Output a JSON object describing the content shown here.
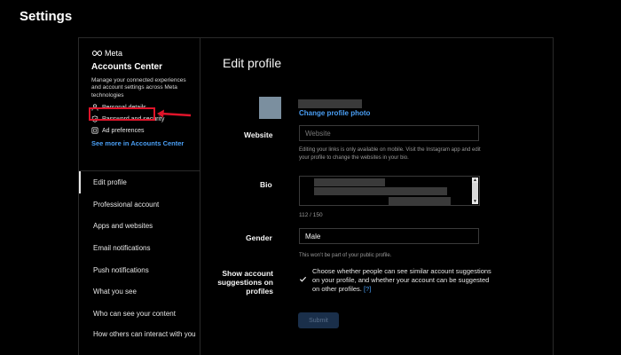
{
  "page": {
    "title": "Settings"
  },
  "accounts_center": {
    "brand": "Meta",
    "title": "Accounts Center",
    "description": "Manage your connected experiences and account settings across Meta technologies",
    "links": [
      {
        "label": "Personal details",
        "icon": "person-icon"
      },
      {
        "label": "Password and security",
        "icon": "shield-check-icon"
      },
      {
        "label": "Ad preferences",
        "icon": "ad-icon"
      }
    ],
    "see_more": "See more in Accounts Center"
  },
  "nav": [
    {
      "label": "Edit profile",
      "active": true
    },
    {
      "label": "Professional account"
    },
    {
      "label": "Apps and websites"
    },
    {
      "label": "Email notifications"
    },
    {
      "label": "Push notifications"
    },
    {
      "label": "What you see"
    },
    {
      "label": "Who can see your content"
    },
    {
      "label": "How others can interact with you"
    }
  ],
  "main": {
    "title": "Edit profile",
    "change_photo": "Change profile photo",
    "website": {
      "label": "Website",
      "placeholder": "Website",
      "help": "Editing your links is only available on mobile. Visit the Instagram app and edit your profile to change the websites in your bio."
    },
    "bio": {
      "label": "Bio",
      "counter": "112 / 150"
    },
    "gender": {
      "label": "Gender",
      "value": "Male",
      "help": "This won’t be part of your public profile."
    },
    "suggestions": {
      "label": "Show account suggestions on profiles",
      "text": "Choose whether people can see similar account suggestions on your profile, and whether your account can be suggested on other profiles.",
      "help_link": "[?]",
      "checked": true
    },
    "submit": "Submit"
  },
  "colors": {
    "link": "#4a9ff5",
    "highlight": "#e0142a",
    "background": "#000000"
  }
}
